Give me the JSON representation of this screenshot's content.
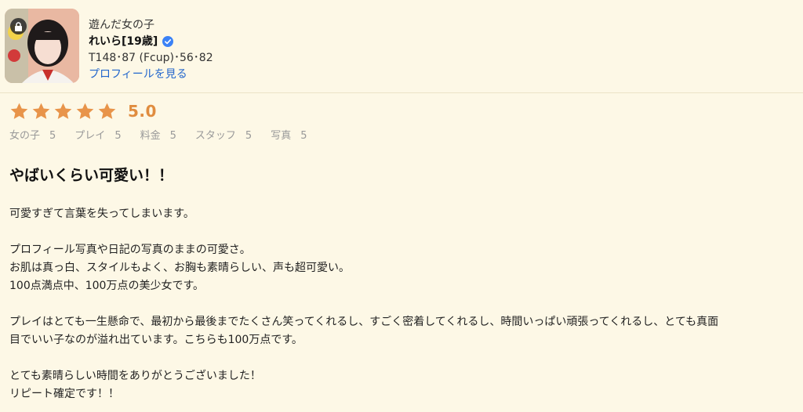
{
  "header": {
    "label": "遊んだ女の子",
    "name": "れいら[19歳]",
    "stats": "T148･87 (Fcup)･56･82",
    "profile_link": "プロフィールを見る"
  },
  "rating": {
    "stars": 5,
    "max_stars": 5,
    "score": "5.0",
    "star_color": "#e8944a"
  },
  "subscores": [
    {
      "label": "女の子",
      "value": "5"
    },
    {
      "label": "プレイ",
      "value": "5"
    },
    {
      "label": "料金",
      "value": "5"
    },
    {
      "label": "スタッフ",
      "value": "5"
    },
    {
      "label": "写真",
      "value": "5"
    }
  ],
  "review": {
    "title": "やばいくらい可愛い！！",
    "lines": [
      "可愛すぎて言葉を失ってしまいます。",
      "",
      "プロフィール写真や日記の写真のままの可愛さ。",
      "お肌は真っ白、スタイルもよく、お胸も素晴らしい、声も超可愛い。",
      "100点満点中、100万点の美少女です。",
      "",
      "プレイはとても一生懸命で、最初から最後までたくさん笑ってくれるし、すごく密着してくれるし、時間いっぱい頑張ってくれるし、とても真面",
      "目でいい子なのが溢れ出ています。こちらも100万点です。",
      "",
      "とても素晴らしい時間をありがとうございました！",
      "リピート確定です！！"
    ]
  },
  "colors": {
    "background": "#fdf8e6",
    "link": "#2266cc",
    "accent": "#e08c3f",
    "verified": "#3b82f6"
  },
  "icons": {
    "lock": "lock-icon",
    "verified": "verified-badge-icon",
    "star": "star-icon"
  }
}
